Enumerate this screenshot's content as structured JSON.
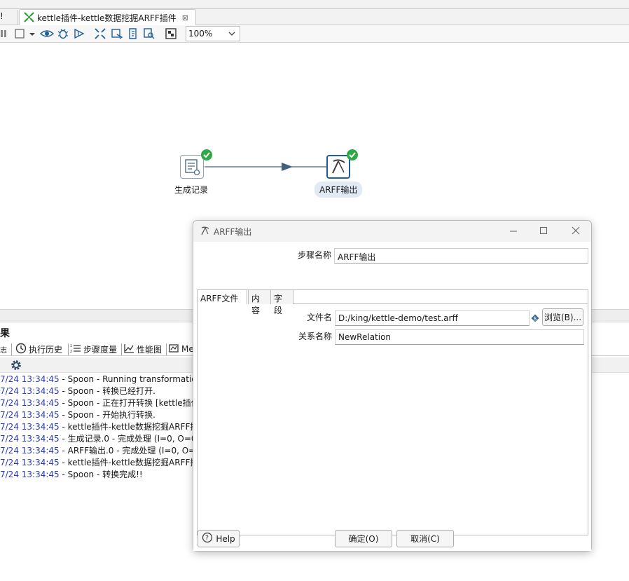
{
  "window": {
    "left_tab_stub": "!",
    "active_tab_title": "kettle插件-kettle数据挖掘ARFF插件",
    "active_tab_close": "⊠"
  },
  "toolbar": {
    "zoom_value": "100%"
  },
  "canvas": {
    "steps": [
      {
        "label": "生成记录",
        "status": "ok"
      },
      {
        "label": "ARFF输出",
        "status": "ok"
      }
    ]
  },
  "results": {
    "title": "果",
    "tabs": [
      "执行历史",
      "步骤度量",
      "性能图",
      "Me"
    ],
    "log_lines": [
      {
        "ts": "7/24 13:34:45",
        "msg": " - Spoon - Running transformation"
      },
      {
        "ts": "7/24 13:34:45",
        "msg": " - Spoon - 转换已经打开."
      },
      {
        "ts": "7/24 13:34:45",
        "msg": " - Spoon - 正在打开转换 [kettle插件"
      },
      {
        "ts": "7/24 13:34:45",
        "msg": " - Spoon - 开始执行转换."
      },
      {
        "ts": "7/24 13:34:45",
        "msg": " - kettle插件-kettle数据挖掘ARFF插件"
      },
      {
        "ts": "7/24 13:34:45",
        "msg": " - 生成记录.0 - 完成处理 (I=0, O=0,"
      },
      {
        "ts": "7/24 13:34:45",
        "msg": " - ARFF输出.0 - 完成处理 (I=0, O=0,"
      },
      {
        "ts": "7/24 13:34:45",
        "msg": " - kettle插件-kettle数据挖掘ARFF插件"
      },
      {
        "ts": "7/24 13:34:45",
        "msg": " - Spoon - 转换完成!!"
      }
    ]
  },
  "dialog": {
    "title": "ARFF输出",
    "step_name_label": "步骤名称",
    "step_name_value": "ARFF输出",
    "tabs": [
      "ARFF文件",
      "内容",
      "字段"
    ],
    "filename_label": "文件名",
    "filename_value": "D:/king/kettle-demo/test.arff",
    "browse_label": "浏览(B)...",
    "relation_label": "关系名称",
    "relation_value": "NewRelation",
    "help_label": "Help",
    "ok_label": "确定(O)",
    "cancel_label": "取消(C)"
  },
  "colors": {
    "step_border_active": "#1f5e9b",
    "status_ok": "#2eaa44",
    "hop_line": "#41607e",
    "log_timestamp": "#2a3bb5"
  }
}
